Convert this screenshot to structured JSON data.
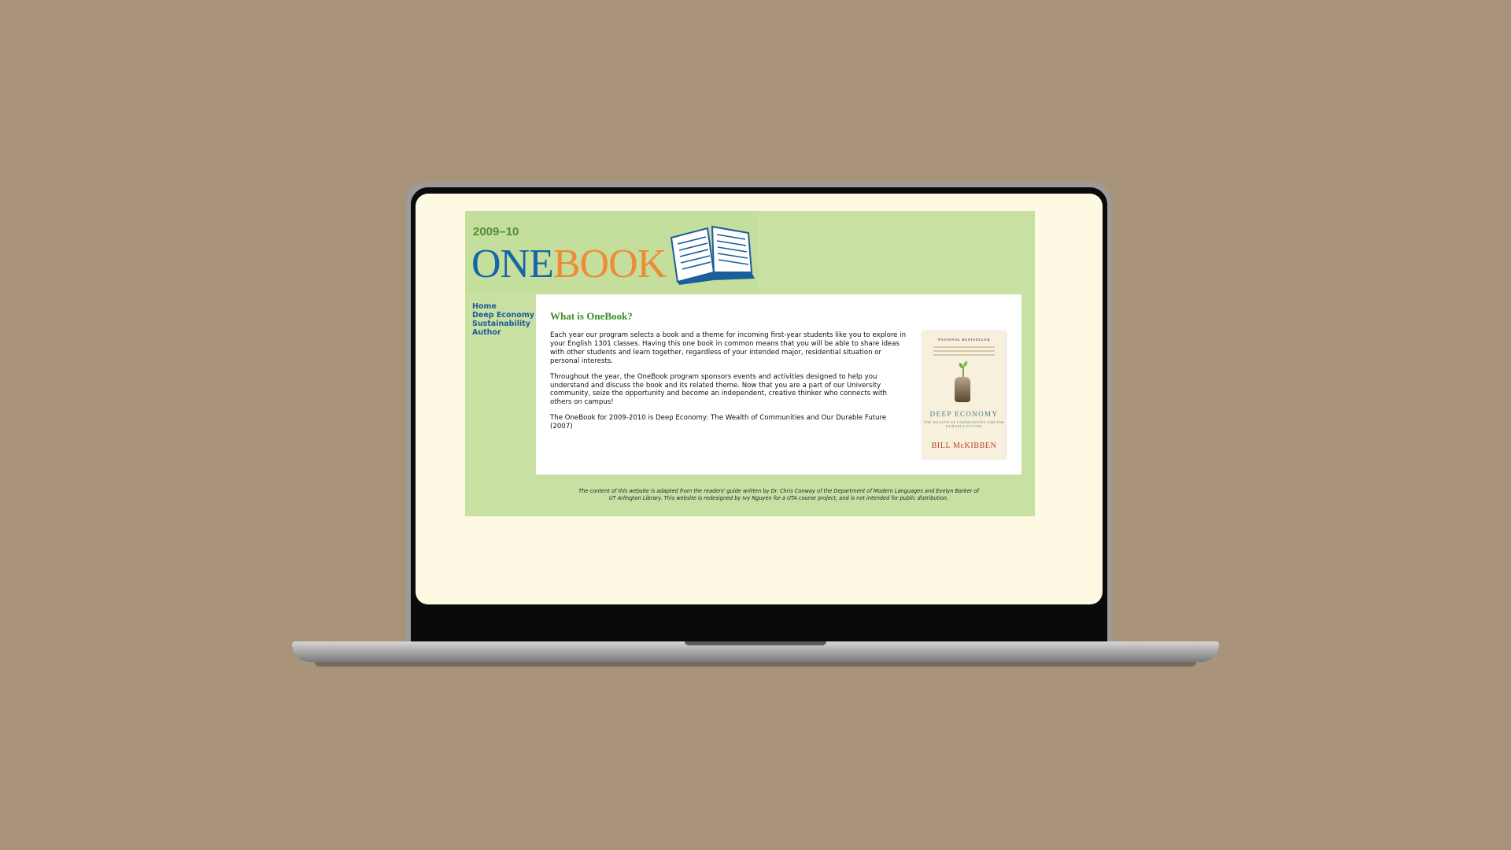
{
  "site": {
    "year": "2009–10",
    "logo_one": "ONE",
    "logo_book": "BOOK"
  },
  "nav": {
    "items": [
      {
        "label": "Home"
      },
      {
        "label": "Deep Economy"
      },
      {
        "label": "Sustainability"
      },
      {
        "label": "Author"
      }
    ]
  },
  "main": {
    "heading": "What is OneBook?",
    "paragraphs": [
      "Each year our program selects a book and a theme for incoming first-year students like you to explore in your English 1301 classes. Having this one book in common means that you will be able to share ideas with other students and learn together, regardless of your intended major, residential situation or personal interests.",
      "Throughout the year, the OneBook program sponsors events and activities designed to help you understand and discuss the book and its related theme. Now that you are a part of our University community, seize the opportunity and become an independent, creative thinker who connects with others on campus!",
      "The OneBook for 2009-2010 is Deep Economy: The Wealth of Communities and Our Durable Future (2007)"
    ]
  },
  "cover": {
    "badge": "NATIONAL BESTSELLER",
    "title": "DEEP ECONOMY",
    "subtitle": "THE WEALTH OF COMMUNITIES AND THE DURABLE FUTURE",
    "author": "BILL McKIBBEN"
  },
  "footer": {
    "line1": "The content of this website is adapted from the readers' guide written by Dr. Chris Conway of the Department of Modern Languages and Evelyn Barker of",
    "line2": "UT Arlington Library. This website is redesigned by Ivy Nguyen for a UTA course project, and is not intended for public distribution."
  },
  "colors": {
    "background": "#aa937b",
    "page_green": "#c8e0a2",
    "screen_cream": "#fdf9e3",
    "logo_blue": "#1466a8",
    "logo_orange": "#ef8a35",
    "heading_green": "#3a8a2a",
    "nav_blue": "#1d5b9a"
  }
}
